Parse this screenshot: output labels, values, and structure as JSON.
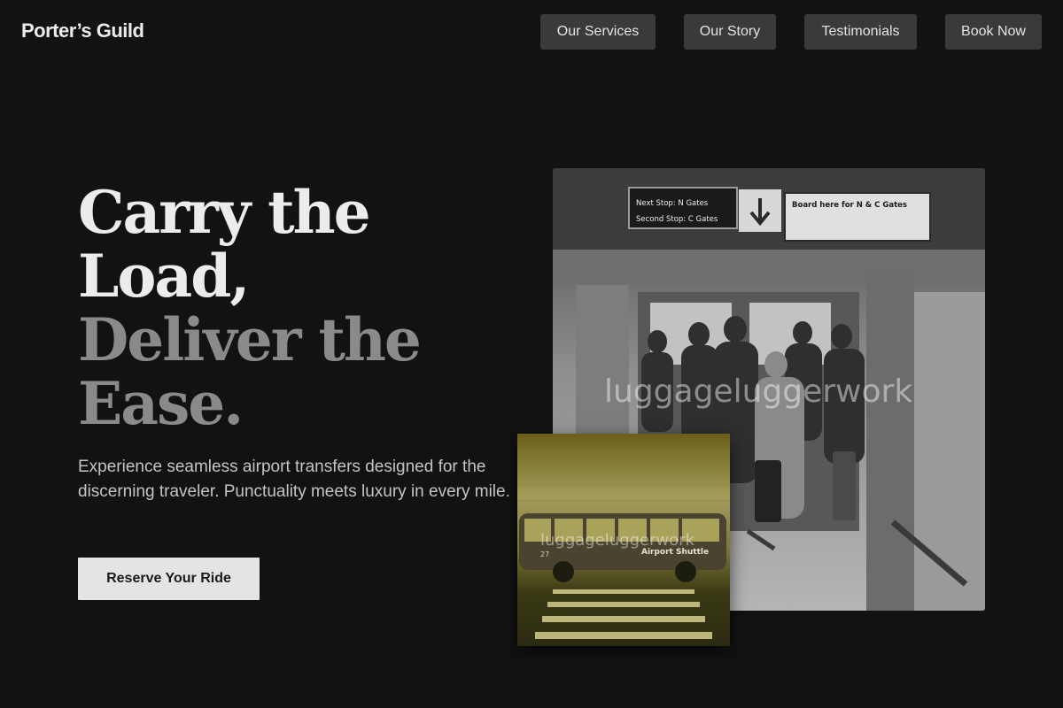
{
  "brand": {
    "name": "Porter’s Guild"
  },
  "nav": {
    "items": [
      {
        "label": "Our Services"
      },
      {
        "label": "Our Story"
      },
      {
        "label": "Testimonials"
      },
      {
        "label": "Book Now"
      }
    ]
  },
  "hero": {
    "title_line1": "Carry the",
    "title_line2": "Load,",
    "title_line3": "Deliver the",
    "title_line4": "Ease.",
    "subtitle": "Experience seamless airport transfers designed for the discerning traveler. Punctuality meets luxury in every mile.",
    "cta_label": "Reserve Your Ride"
  },
  "photos": {
    "main_watermark": "luggageluggerwork",
    "shuttle_watermark": "luggageluggerwork",
    "train_sign_next": "Next Stop: N Gates",
    "train_sign_second": "Second Stop: C Gates",
    "train_sign_board": "Board here for N & C Gates",
    "bus_number": "27",
    "bus_sign": "Airport Shuttle"
  },
  "colors": {
    "background": "#121212",
    "nav_button": "#3a3a3a",
    "cta_button": "#e4e4e4",
    "title_light": "#ececec",
    "title_dim": "#8a8a8a"
  }
}
